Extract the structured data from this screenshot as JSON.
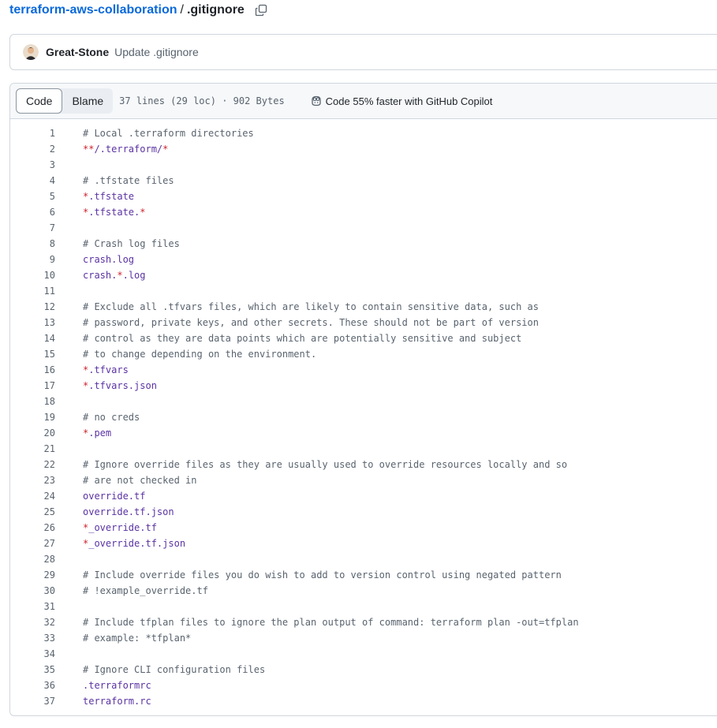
{
  "breadcrumb": {
    "repo": "terraform-aws-collaboration",
    "separator": "/",
    "file": ".gitignore"
  },
  "commit": {
    "author": "Great-Stone",
    "message": "Update .gitignore"
  },
  "file_header": {
    "tabs": [
      "Code",
      "Blame"
    ],
    "active_tab": "Code",
    "info": "37 lines (29 loc) · 902 Bytes",
    "copilot_text": "Code 55% faster with GitHub Copilot"
  },
  "colors": {
    "link": "#0969da",
    "comment": "#59636e",
    "glob": "#cf222e",
    "name": "#5a32a3"
  },
  "code_lines": [
    {
      "n": "1",
      "segs": [
        {
          "t": "# Local .terraform directories",
          "c": "comment"
        }
      ]
    },
    {
      "n": "2",
      "segs": [
        {
          "t": "**",
          "c": "glob"
        },
        {
          "t": "/.terraform/",
          "c": "name"
        },
        {
          "t": "*",
          "c": "glob"
        }
      ]
    },
    {
      "n": "3",
      "segs": []
    },
    {
      "n": "4",
      "segs": [
        {
          "t": "# .tfstate files",
          "c": "comment"
        }
      ]
    },
    {
      "n": "5",
      "segs": [
        {
          "t": "*",
          "c": "glob"
        },
        {
          "t": ".tfstate",
          "c": "name"
        }
      ]
    },
    {
      "n": "6",
      "segs": [
        {
          "t": "*",
          "c": "glob"
        },
        {
          "t": ".tfstate.",
          "c": "name"
        },
        {
          "t": "*",
          "c": "glob"
        }
      ]
    },
    {
      "n": "7",
      "segs": []
    },
    {
      "n": "8",
      "segs": [
        {
          "t": "# Crash log files",
          "c": "comment"
        }
      ]
    },
    {
      "n": "9",
      "segs": [
        {
          "t": "crash.log",
          "c": "name"
        }
      ]
    },
    {
      "n": "10",
      "segs": [
        {
          "t": "crash.",
          "c": "name"
        },
        {
          "t": "*",
          "c": "glob"
        },
        {
          "t": ".log",
          "c": "name"
        }
      ]
    },
    {
      "n": "11",
      "segs": []
    },
    {
      "n": "12",
      "segs": [
        {
          "t": "# Exclude all .tfvars files, which are likely to contain sensitive data, such as",
          "c": "comment"
        }
      ]
    },
    {
      "n": "13",
      "segs": [
        {
          "t": "# password, private keys, and other secrets. These should not be part of version",
          "c": "comment"
        }
      ]
    },
    {
      "n": "14",
      "segs": [
        {
          "t": "# control as they are data points which are potentially sensitive and subject",
          "c": "comment"
        }
      ]
    },
    {
      "n": "15",
      "segs": [
        {
          "t": "# to change depending on the environment.",
          "c": "comment"
        }
      ]
    },
    {
      "n": "16",
      "segs": [
        {
          "t": "*",
          "c": "glob"
        },
        {
          "t": ".tfvars",
          "c": "name"
        }
      ]
    },
    {
      "n": "17",
      "segs": [
        {
          "t": "*",
          "c": "glob"
        },
        {
          "t": ".tfvars.json",
          "c": "name"
        }
      ]
    },
    {
      "n": "18",
      "segs": []
    },
    {
      "n": "19",
      "segs": [
        {
          "t": "# no creds",
          "c": "comment"
        }
      ]
    },
    {
      "n": "20",
      "segs": [
        {
          "t": "*",
          "c": "glob"
        },
        {
          "t": ".pem",
          "c": "name"
        }
      ]
    },
    {
      "n": "21",
      "segs": []
    },
    {
      "n": "22",
      "segs": [
        {
          "t": "# Ignore override files as they are usually used to override resources locally and so",
          "c": "comment"
        }
      ]
    },
    {
      "n": "23",
      "segs": [
        {
          "t": "# are not checked in",
          "c": "comment"
        }
      ]
    },
    {
      "n": "24",
      "segs": [
        {
          "t": "override.tf",
          "c": "name"
        }
      ]
    },
    {
      "n": "25",
      "segs": [
        {
          "t": "override.tf.json",
          "c": "name"
        }
      ]
    },
    {
      "n": "26",
      "segs": [
        {
          "t": "*",
          "c": "glob"
        },
        {
          "t": "_override.tf",
          "c": "name"
        }
      ]
    },
    {
      "n": "27",
      "segs": [
        {
          "t": "*",
          "c": "glob"
        },
        {
          "t": "_override.tf.json",
          "c": "name"
        }
      ]
    },
    {
      "n": "28",
      "segs": []
    },
    {
      "n": "29",
      "segs": [
        {
          "t": "# Include override files you do wish to add to version control using negated pattern",
          "c": "comment"
        }
      ]
    },
    {
      "n": "30",
      "segs": [
        {
          "t": "# !example_override.tf",
          "c": "comment"
        }
      ]
    },
    {
      "n": "31",
      "segs": []
    },
    {
      "n": "32",
      "segs": [
        {
          "t": "# Include tfplan files to ignore the plan output of command: terraform plan -out=tfplan",
          "c": "comment"
        }
      ]
    },
    {
      "n": "33",
      "segs": [
        {
          "t": "# example: *tfplan*",
          "c": "comment"
        }
      ]
    },
    {
      "n": "34",
      "segs": []
    },
    {
      "n": "35",
      "segs": [
        {
          "t": "# Ignore CLI configuration files",
          "c": "comment"
        }
      ]
    },
    {
      "n": "36",
      "segs": [
        {
          "t": ".terraformrc",
          "c": "name"
        }
      ]
    },
    {
      "n": "37",
      "segs": [
        {
          "t": "terraform.rc",
          "c": "name"
        }
      ]
    }
  ]
}
